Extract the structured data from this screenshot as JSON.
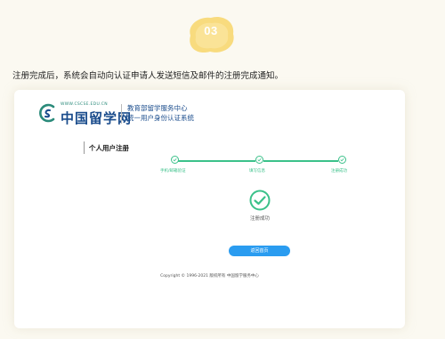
{
  "badge": {
    "number": "03"
  },
  "intro_text": "注册完成后，系统会自动向认证申请人发送短信及邮件的注册完成通知。",
  "logo": {
    "url_text": "WWW.CSCSE.EDU.CN",
    "name": "中国留学网"
  },
  "system": {
    "line1": "教育部留学服务中心",
    "line2": "统一用户身份认证系统"
  },
  "section_title": "个人用户注册",
  "steps": [
    {
      "label": "手机/邮箱验证"
    },
    {
      "label": "填写信息"
    },
    {
      "label": "注册成功"
    }
  ],
  "success_text": "注册成功",
  "back_button_label": "返回首页",
  "copyright": "Copyright © 1996-2021 版权所有 中国留学服务中心",
  "colors": {
    "accent_green": "#3bc18a",
    "button_blue": "#2a9cf0",
    "badge_yellow": "#f7d66a",
    "brand_blue": "#1a4c8c"
  }
}
